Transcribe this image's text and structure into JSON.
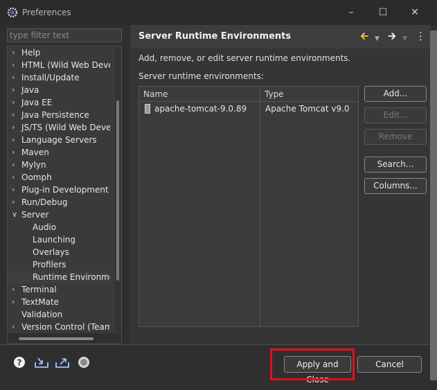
{
  "window": {
    "title": "Preferences"
  },
  "nav": {
    "filter_placeholder": "type filter text",
    "items": [
      {
        "label": "Help",
        "expanded": false
      },
      {
        "label": "HTML (Wild Web Develo",
        "expanded": false
      },
      {
        "label": "Install/Update",
        "expanded": false
      },
      {
        "label": "Java",
        "expanded": false
      },
      {
        "label": "Java EE",
        "expanded": false
      },
      {
        "label": "Java Persistence",
        "expanded": false
      },
      {
        "label": "JS/TS (Wild Web Develop",
        "expanded": false
      },
      {
        "label": "Language Servers",
        "expanded": false
      },
      {
        "label": "Maven",
        "expanded": false
      },
      {
        "label": "Mylyn",
        "expanded": false
      },
      {
        "label": "Oomph",
        "expanded": false
      },
      {
        "label": "Plug-in Development",
        "expanded": false
      },
      {
        "label": "Run/Debug",
        "expanded": false
      },
      {
        "label": "Server",
        "expanded": true
      },
      {
        "label": "Audio",
        "child": true
      },
      {
        "label": "Launching",
        "child": true
      },
      {
        "label": "Overlays",
        "child": true
      },
      {
        "label": "Profilers",
        "child": true
      },
      {
        "label": "Runtime Environment",
        "child": true,
        "selected": true
      },
      {
        "label": "Terminal",
        "expanded": false
      },
      {
        "label": "TextMate",
        "expanded": false
      },
      {
        "label": "Validation",
        "leaf": true
      },
      {
        "label": "Version Control (Team)",
        "expanded": false
      }
    ]
  },
  "page": {
    "title": "Server Runtime Environments",
    "description": "Add, remove, or edit server runtime environments.",
    "list_label": "Server runtime environments:",
    "table": {
      "columns": [
        "Name",
        "Type"
      ],
      "rows": [
        {
          "name": "apache-tomcat-9.0.89",
          "type": "Apache Tomcat v9.0"
        }
      ]
    },
    "buttons": {
      "add": "Add...",
      "edit": "Edit...",
      "remove": "Remove",
      "search": "Search...",
      "columns": "Columns..."
    }
  },
  "footer": {
    "apply_close": "Apply and Close",
    "cancel": "Cancel",
    "icons": [
      "help-icon",
      "import-icon",
      "export-icon",
      "oomph-icon"
    ]
  },
  "colors": {
    "highlight": "#e0101e",
    "back_arrow": "#f5c542",
    "forward_arrow": "#f0f0f0"
  }
}
